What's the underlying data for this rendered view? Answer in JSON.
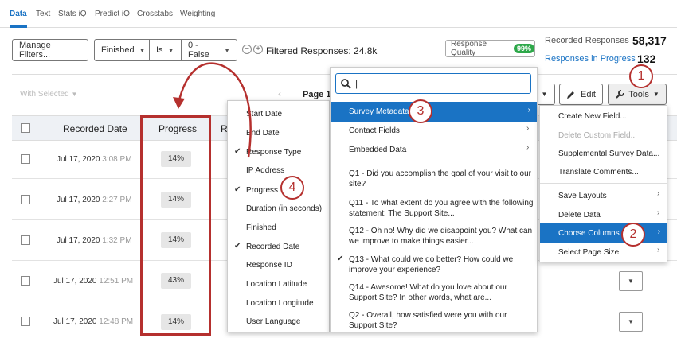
{
  "tabs": [
    "Data",
    "Text",
    "Stats iQ",
    "Predict iQ",
    "Crosstabs",
    "Weighting"
  ],
  "filter_bar": {
    "manage_filters": "Manage Filters...",
    "field": "Finished",
    "operator": "Is",
    "value": "0 - False",
    "minus": "−",
    "plus": "+",
    "filtered_responses": "Filtered Responses: 24.8k"
  },
  "response_quality": {
    "label": "Response Quality",
    "badge": "99%"
  },
  "stats": {
    "recorded_label": "Recorded Responses",
    "recorded_value": "58,317",
    "in_progress_label": "Responses in Progress",
    "in_progress_value": "132"
  },
  "toolbar": {
    "with_selected": "With Selected",
    "page": "Page 1",
    "edit": "Edit",
    "tools": "Tools"
  },
  "table": {
    "headers": {
      "recorded_date": "Recorded Date",
      "progress": "Progress",
      "r": "R"
    },
    "rows": [
      {
        "date": "Jul 17, 2020",
        "time": "3:08 PM",
        "progress": "14%"
      },
      {
        "date": "Jul 17, 2020",
        "time": "2:27 PM",
        "progress": "14%"
      },
      {
        "date": "Jul 17, 2020",
        "time": "1:32 PM",
        "progress": "14%"
      },
      {
        "date": "Jul 17, 2020",
        "time": "12:51 PM",
        "progress": "43%"
      },
      {
        "date": "Jul 17, 2020",
        "time": "12:48 PM",
        "progress": "14%"
      }
    ]
  },
  "columns_menu": [
    {
      "label": "Start Date",
      "checked": false
    },
    {
      "label": "End Date",
      "checked": false
    },
    {
      "label": "Response Type",
      "checked": true
    },
    {
      "label": "IP Address",
      "checked": false
    },
    {
      "label": "Progress",
      "checked": true
    },
    {
      "label": "Duration (in seconds)",
      "checked": false
    },
    {
      "label": "Finished",
      "checked": false
    },
    {
      "label": "Recorded Date",
      "checked": true
    },
    {
      "label": "Response ID",
      "checked": false
    },
    {
      "label": "Location Latitude",
      "checked": false
    },
    {
      "label": "Location Longitude",
      "checked": false
    },
    {
      "label": "User Language",
      "checked": false
    }
  ],
  "source_menu": {
    "search_placeholder": "|",
    "groups": [
      "Survey Metadata",
      "Contact Fields",
      "Embedded Data"
    ],
    "questions": [
      {
        "line1": "Q1 - Did you accomplish the goal of your visit to our",
        "line2": "site?",
        "checked": false
      },
      {
        "line1": "Q11 - To what extent do you agree with the following",
        "line2": "statement: The Support Site...",
        "checked": false
      },
      {
        "line1": "Q12 - Oh no! Why did we disappoint you? What can",
        "line2": "we improve to make things easier...",
        "checked": false
      },
      {
        "line1": "Q13 - What could we do better? How could we",
        "line2": "improve your experience?",
        "checked": true
      },
      {
        "line1": "Q14 - Awesome! What do you love about our",
        "line2": "Support Site? In other words, what are...",
        "checked": false
      },
      {
        "line1": "Q2 - Overall, how satisfied were you with our",
        "line2": "Support Site?",
        "checked": false
      }
    ]
  },
  "tools_menu": [
    {
      "label": "Create New Field...",
      "disabled": false,
      "arrow": false
    },
    {
      "label": "Delete Custom Field...",
      "disabled": true,
      "arrow": false
    },
    {
      "label": "Supplemental Survey Data...",
      "disabled": false,
      "arrow": false
    },
    {
      "label": "Translate Comments...",
      "disabled": false,
      "arrow": false
    },
    {
      "label": "Save Layouts",
      "disabled": false,
      "arrow": true
    },
    {
      "label": "Delete Data",
      "disabled": false,
      "arrow": true
    },
    {
      "label": "Choose Columns",
      "disabled": false,
      "arrow": true
    },
    {
      "label": "Select Page Size",
      "disabled": false,
      "arrow": true
    }
  ],
  "callouts": [
    "1",
    "2",
    "3",
    "4"
  ],
  "colors": {
    "accent": "#1a73c4",
    "annotation": "#b5302e",
    "badge_green": "#2ea84a"
  }
}
